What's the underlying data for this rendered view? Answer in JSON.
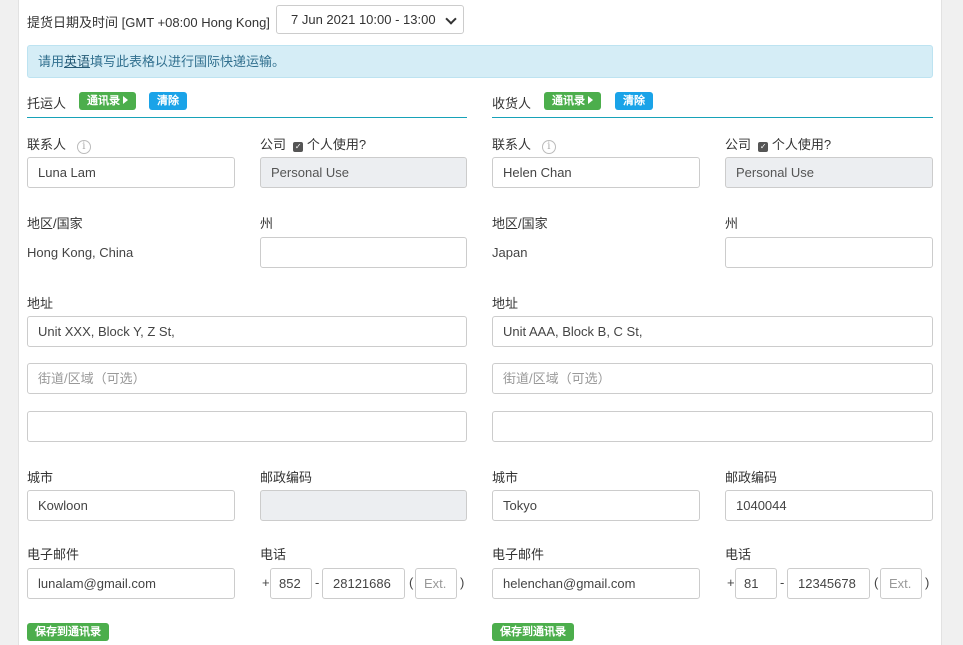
{
  "pickup": {
    "label": "提货日期及时间",
    "tz": "[GMT +08:00 Hong Kong]",
    "value": "7 Jun 2021 10:00 - 13:00"
  },
  "notice": {
    "pre": "请用",
    "link": "英语",
    "post": "填写此表格以进行国际快递运输。"
  },
  "labels": {
    "contact": "联系人",
    "company": "公司",
    "personal_use": "个人使用?",
    "region": "地区/国家",
    "state": "州",
    "address": "地址",
    "street_placeholder": "街道/区域（可选）",
    "city": "城市",
    "postal": "邮政编码",
    "email": "电子邮件",
    "phone": "电话",
    "ext_placeholder": "Ext.",
    "address_book": "通讯录",
    "clear": "清除",
    "save": "保存到通讯录",
    "plus": "+",
    "dash": "-",
    "lparen": "(",
    "rparen": ")"
  },
  "shipper": {
    "title": "托运人",
    "contact": "Luna Lam",
    "company": "Personal Use",
    "region": "Hong Kong, China",
    "state": "",
    "address1": "Unit XXX, Block Y, Z St,",
    "address2": "",
    "address3": "",
    "city": "Kowloon",
    "postal": "",
    "email": "lunalam@gmail.com",
    "phone_cc": "852",
    "phone_num": "28121686",
    "phone_ext": ""
  },
  "receiver": {
    "title": "收货人",
    "contact": "Helen Chan",
    "company": "Personal Use",
    "region": "Japan",
    "state": "",
    "address1": "Unit AAA, Block B, C St,",
    "address2": "",
    "address3": "",
    "city": "Tokyo",
    "postal": "1040044",
    "email": "helenchan@gmail.com",
    "phone_cc": "81",
    "phone_num": "12345678",
    "phone_ext": ""
  }
}
